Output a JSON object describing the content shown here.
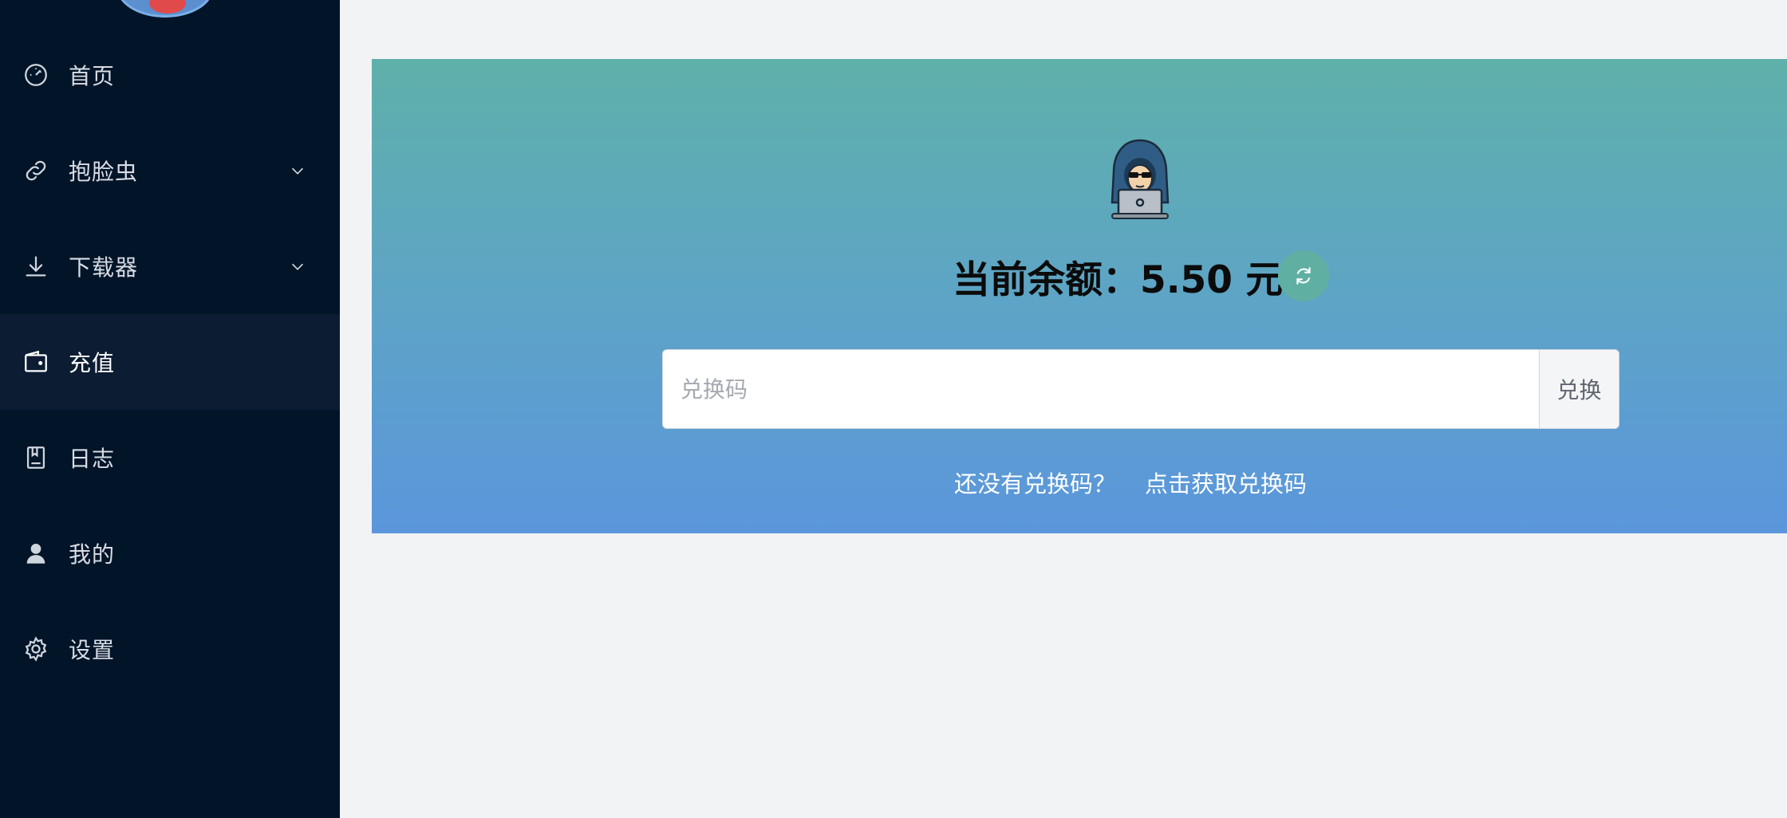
{
  "sidebar": {
    "items": [
      {
        "label": "首页",
        "icon": "dashboard-icon",
        "expandable": false,
        "active": false
      },
      {
        "label": "抱脸虫",
        "icon": "link-icon",
        "expandable": true,
        "active": false
      },
      {
        "label": "下载器",
        "icon": "download-icon",
        "expandable": true,
        "active": false
      },
      {
        "label": "充值",
        "icon": "wallet-icon",
        "expandable": false,
        "active": true
      },
      {
        "label": "日志",
        "icon": "book-icon",
        "expandable": false,
        "active": false
      },
      {
        "label": "我的",
        "icon": "user-icon",
        "expandable": false,
        "active": false
      },
      {
        "label": "设置",
        "icon": "gear-icon",
        "expandable": false,
        "active": false
      }
    ]
  },
  "recharge": {
    "balance_label": "当前余额：5.50 元",
    "redeem_placeholder": "兑换码",
    "redeem_button": "兑换",
    "hint_question": "还没有兑换码？",
    "hint_link": "点击获取兑换码"
  },
  "colors": {
    "sidebar_bg": "#021428",
    "sidebar_active": "#0b1c33",
    "card_gradient_top": "#5fb0aa",
    "card_gradient_bottom": "#5b96dc",
    "refresh_button": "#5fb0a3"
  }
}
